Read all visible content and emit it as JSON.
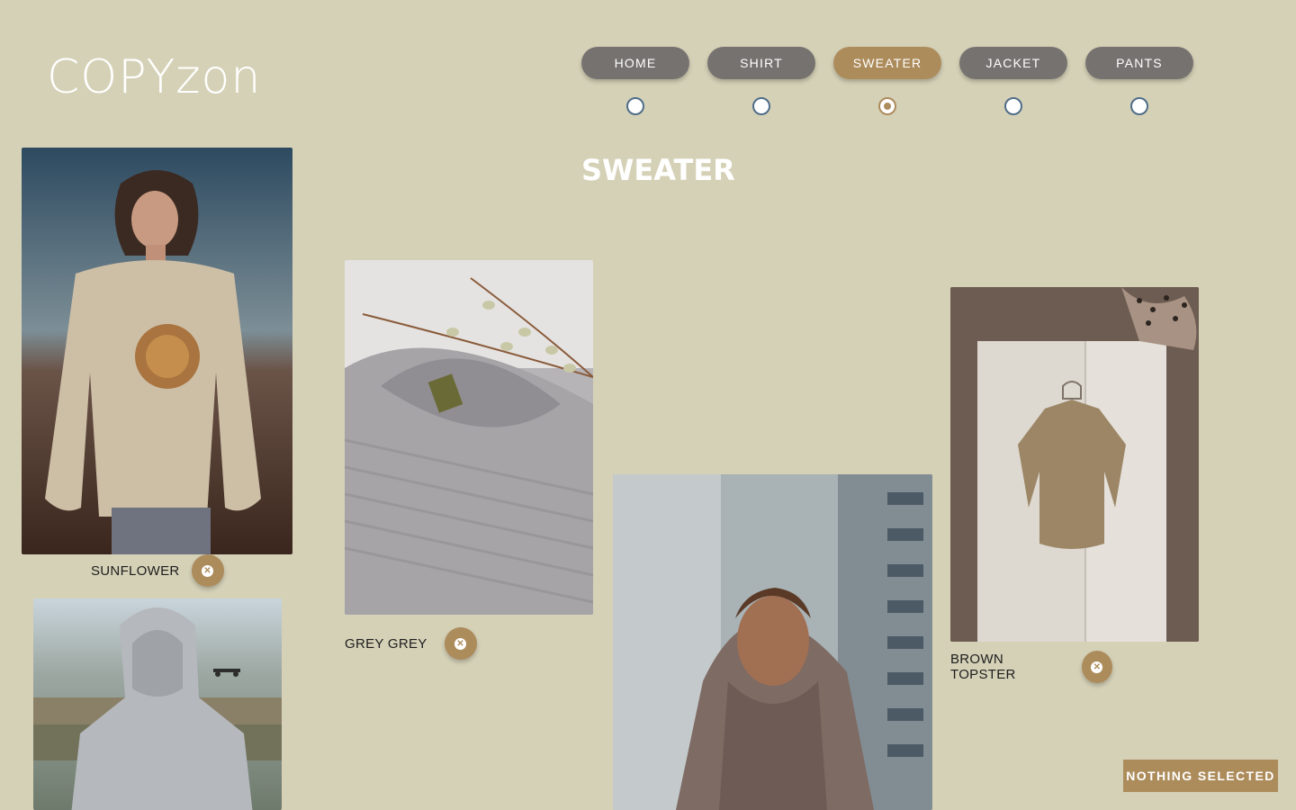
{
  "logo": "COPYzon",
  "nav": [
    {
      "label": "HOME",
      "active": false
    },
    {
      "label": "SHIRT",
      "active": false
    },
    {
      "label": "SWEATER",
      "active": true
    },
    {
      "label": "JACKET",
      "active": false
    },
    {
      "label": "PANTS",
      "active": false
    }
  ],
  "heading": "SWEATER",
  "products": [
    {
      "name": "SUNFLOWER"
    },
    {
      "name": "GREY GREY"
    },
    {
      "name": "BROWN TOPSTER"
    },
    {
      "name": "",
      "note": "hooded grey sweater, no caption visible"
    },
    {
      "name": "",
      "note": "brown hoodie, no caption visible"
    }
  ],
  "status": "NOTHING SELECTED",
  "colors": {
    "background": "#d5d1b7",
    "nav_inactive": "#767270",
    "accent": "#ad8c5c",
    "text": "#1d1d1d"
  },
  "icons": {
    "remove": "close-circle-icon",
    "radio": "radio-indicator-icon"
  }
}
